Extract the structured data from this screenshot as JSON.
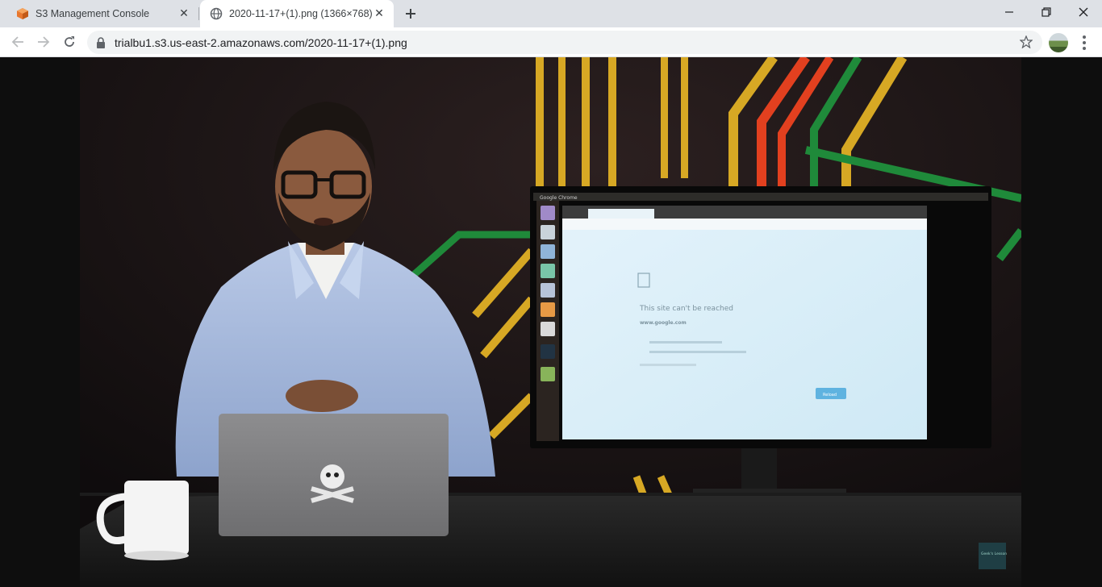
{
  "tabs": [
    {
      "title": "S3 Management Console",
      "icon": "aws-s3-icon",
      "active": false
    },
    {
      "title": "2020-11-17+(1).png (1366×768)",
      "icon": "globe-icon",
      "active": true
    }
  ],
  "toolbar": {
    "url": "trialbu1.s3.us-east-2.amazonaws.com/2020-11-17+(1).png"
  },
  "image": {
    "monitor_window_title": "Google Chrome",
    "error_heading": "This site can't be reached",
    "error_domain": "www.google.com",
    "reload_label": "Reload",
    "watermark": "Geek's Lesson"
  },
  "colors": {
    "tabstrip": "#dee1e6",
    "omnibox": "#f1f3f4",
    "s3_orange": "#e8772e",
    "stage_green": "#1f8a3a",
    "stage_yellow": "#d7a824",
    "stage_red": "#e2401f"
  }
}
